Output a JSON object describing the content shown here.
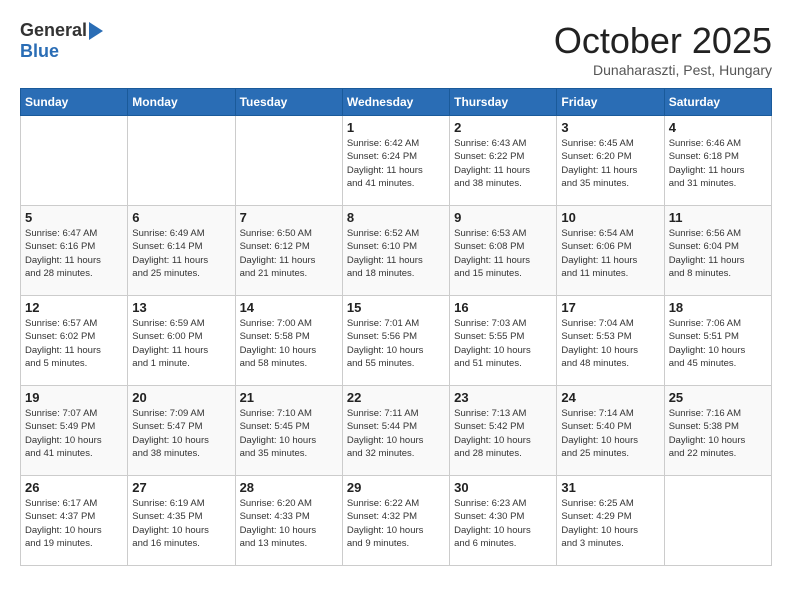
{
  "header": {
    "logo_general": "General",
    "logo_blue": "Blue",
    "title": "October 2025",
    "location": "Dunaharaszti, Pest, Hungary"
  },
  "days_of_week": [
    "Sunday",
    "Monday",
    "Tuesday",
    "Wednesday",
    "Thursday",
    "Friday",
    "Saturday"
  ],
  "weeks": [
    [
      {
        "day": "",
        "info": ""
      },
      {
        "day": "",
        "info": ""
      },
      {
        "day": "",
        "info": ""
      },
      {
        "day": "1",
        "info": "Sunrise: 6:42 AM\nSunset: 6:24 PM\nDaylight: 11 hours\nand 41 minutes."
      },
      {
        "day": "2",
        "info": "Sunrise: 6:43 AM\nSunset: 6:22 PM\nDaylight: 11 hours\nand 38 minutes."
      },
      {
        "day": "3",
        "info": "Sunrise: 6:45 AM\nSunset: 6:20 PM\nDaylight: 11 hours\nand 35 minutes."
      },
      {
        "day": "4",
        "info": "Sunrise: 6:46 AM\nSunset: 6:18 PM\nDaylight: 11 hours\nand 31 minutes."
      }
    ],
    [
      {
        "day": "5",
        "info": "Sunrise: 6:47 AM\nSunset: 6:16 PM\nDaylight: 11 hours\nand 28 minutes."
      },
      {
        "day": "6",
        "info": "Sunrise: 6:49 AM\nSunset: 6:14 PM\nDaylight: 11 hours\nand 25 minutes."
      },
      {
        "day": "7",
        "info": "Sunrise: 6:50 AM\nSunset: 6:12 PM\nDaylight: 11 hours\nand 21 minutes."
      },
      {
        "day": "8",
        "info": "Sunrise: 6:52 AM\nSunset: 6:10 PM\nDaylight: 11 hours\nand 18 minutes."
      },
      {
        "day": "9",
        "info": "Sunrise: 6:53 AM\nSunset: 6:08 PM\nDaylight: 11 hours\nand 15 minutes."
      },
      {
        "day": "10",
        "info": "Sunrise: 6:54 AM\nSunset: 6:06 PM\nDaylight: 11 hours\nand 11 minutes."
      },
      {
        "day": "11",
        "info": "Sunrise: 6:56 AM\nSunset: 6:04 PM\nDaylight: 11 hours\nand 8 minutes."
      }
    ],
    [
      {
        "day": "12",
        "info": "Sunrise: 6:57 AM\nSunset: 6:02 PM\nDaylight: 11 hours\nand 5 minutes."
      },
      {
        "day": "13",
        "info": "Sunrise: 6:59 AM\nSunset: 6:00 PM\nDaylight: 11 hours\nand 1 minute."
      },
      {
        "day": "14",
        "info": "Sunrise: 7:00 AM\nSunset: 5:58 PM\nDaylight: 10 hours\nand 58 minutes."
      },
      {
        "day": "15",
        "info": "Sunrise: 7:01 AM\nSunset: 5:56 PM\nDaylight: 10 hours\nand 55 minutes."
      },
      {
        "day": "16",
        "info": "Sunrise: 7:03 AM\nSunset: 5:55 PM\nDaylight: 10 hours\nand 51 minutes."
      },
      {
        "day": "17",
        "info": "Sunrise: 7:04 AM\nSunset: 5:53 PM\nDaylight: 10 hours\nand 48 minutes."
      },
      {
        "day": "18",
        "info": "Sunrise: 7:06 AM\nSunset: 5:51 PM\nDaylight: 10 hours\nand 45 minutes."
      }
    ],
    [
      {
        "day": "19",
        "info": "Sunrise: 7:07 AM\nSunset: 5:49 PM\nDaylight: 10 hours\nand 41 minutes."
      },
      {
        "day": "20",
        "info": "Sunrise: 7:09 AM\nSunset: 5:47 PM\nDaylight: 10 hours\nand 38 minutes."
      },
      {
        "day": "21",
        "info": "Sunrise: 7:10 AM\nSunset: 5:45 PM\nDaylight: 10 hours\nand 35 minutes."
      },
      {
        "day": "22",
        "info": "Sunrise: 7:11 AM\nSunset: 5:44 PM\nDaylight: 10 hours\nand 32 minutes."
      },
      {
        "day": "23",
        "info": "Sunrise: 7:13 AM\nSunset: 5:42 PM\nDaylight: 10 hours\nand 28 minutes."
      },
      {
        "day": "24",
        "info": "Sunrise: 7:14 AM\nSunset: 5:40 PM\nDaylight: 10 hours\nand 25 minutes."
      },
      {
        "day": "25",
        "info": "Sunrise: 7:16 AM\nSunset: 5:38 PM\nDaylight: 10 hours\nand 22 minutes."
      }
    ],
    [
      {
        "day": "26",
        "info": "Sunrise: 6:17 AM\nSunset: 4:37 PM\nDaylight: 10 hours\nand 19 minutes."
      },
      {
        "day": "27",
        "info": "Sunrise: 6:19 AM\nSunset: 4:35 PM\nDaylight: 10 hours\nand 16 minutes."
      },
      {
        "day": "28",
        "info": "Sunrise: 6:20 AM\nSunset: 4:33 PM\nDaylight: 10 hours\nand 13 minutes."
      },
      {
        "day": "29",
        "info": "Sunrise: 6:22 AM\nSunset: 4:32 PM\nDaylight: 10 hours\nand 9 minutes."
      },
      {
        "day": "30",
        "info": "Sunrise: 6:23 AM\nSunset: 4:30 PM\nDaylight: 10 hours\nand 6 minutes."
      },
      {
        "day": "31",
        "info": "Sunrise: 6:25 AM\nSunset: 4:29 PM\nDaylight: 10 hours\nand 3 minutes."
      },
      {
        "day": "",
        "info": ""
      }
    ]
  ]
}
